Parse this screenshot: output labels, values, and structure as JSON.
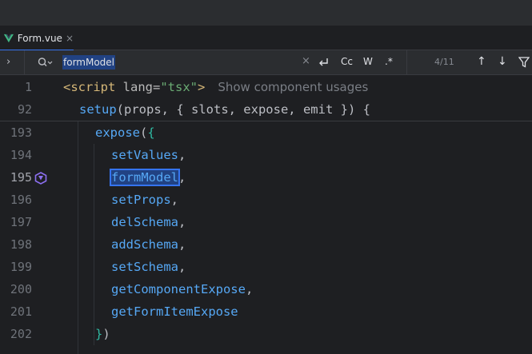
{
  "tab": {
    "label": "Form.vue",
    "close": "×"
  },
  "find": {
    "expand": "›",
    "query": "formModel",
    "clear": "×",
    "opt_cc": "Cc",
    "opt_w": "W",
    "opt_regex": ".*",
    "count": "4/11",
    "prev": "↑",
    "next": "↓"
  },
  "sticky": [
    {
      "num": "1",
      "code": "script_line"
    },
    {
      "num": "92",
      "code": "setup_line"
    }
  ],
  "script_line": {
    "open": "<script",
    "attr": " lang=",
    "val": "\"tsx\"",
    "close": ">",
    "hint": "Show component usages"
  },
  "setup_line": {
    "fn": "setup",
    "rest": "(props, { slots, expose, emit }) {"
  },
  "lines": [
    {
      "num": "193",
      "text": "expose({"
    },
    {
      "num": "194",
      "text": "setValues,"
    },
    {
      "num": "195",
      "text": "formModel,"
    },
    {
      "num": "196",
      "text": "setProps,"
    },
    {
      "num": "197",
      "text": "delSchema,"
    },
    {
      "num": "198",
      "text": "addSchema,"
    },
    {
      "num": "199",
      "text": "setSchema,"
    },
    {
      "num": "200",
      "text": "getComponentExpose,"
    },
    {
      "num": "201",
      "text": "getFormItemExpose"
    },
    {
      "num": "202",
      "text": "})"
    }
  ],
  "colors": {
    "accent": "#3574f0",
    "background": "#1e1f22",
    "panel": "#2b2d30",
    "vue_green": "#41b883"
  }
}
